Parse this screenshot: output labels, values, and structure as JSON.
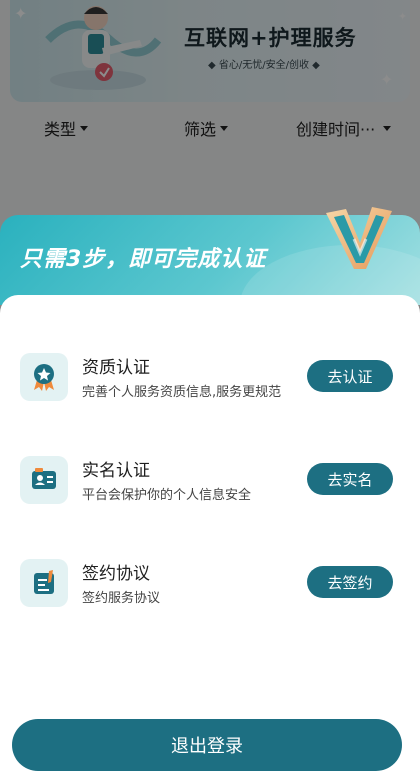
{
  "banner": {
    "title": "互联网+护理服务",
    "subtitle": "◆ 省心/无忧/安全/创收 ◆"
  },
  "filters": [
    {
      "label": "类型"
    },
    {
      "label": "筛选"
    },
    {
      "label": "创建时间···"
    }
  ],
  "sheet": {
    "title": "只需3步，即可完成认证",
    "steps": [
      {
        "title": "资质认证",
        "desc": "完善个人服务资质信息,服务更规范",
        "button": "去认证",
        "icon": "certificate-badge-icon"
      },
      {
        "title": "实名认证",
        "desc": "平台会保护你的个人信息安全",
        "button": "去实名",
        "icon": "id-card-icon"
      },
      {
        "title": "签约协议",
        "desc": "签约服务协议",
        "button": "去签约",
        "icon": "contract-sign-icon"
      }
    ]
  },
  "logout": {
    "label": "退出登录"
  },
  "colors": {
    "primary": "#1d6f82",
    "header_gradient_start": "#2ab1be",
    "header_gradient_end": "#a4e0e2",
    "icon_bg": "#e3f2f3"
  }
}
